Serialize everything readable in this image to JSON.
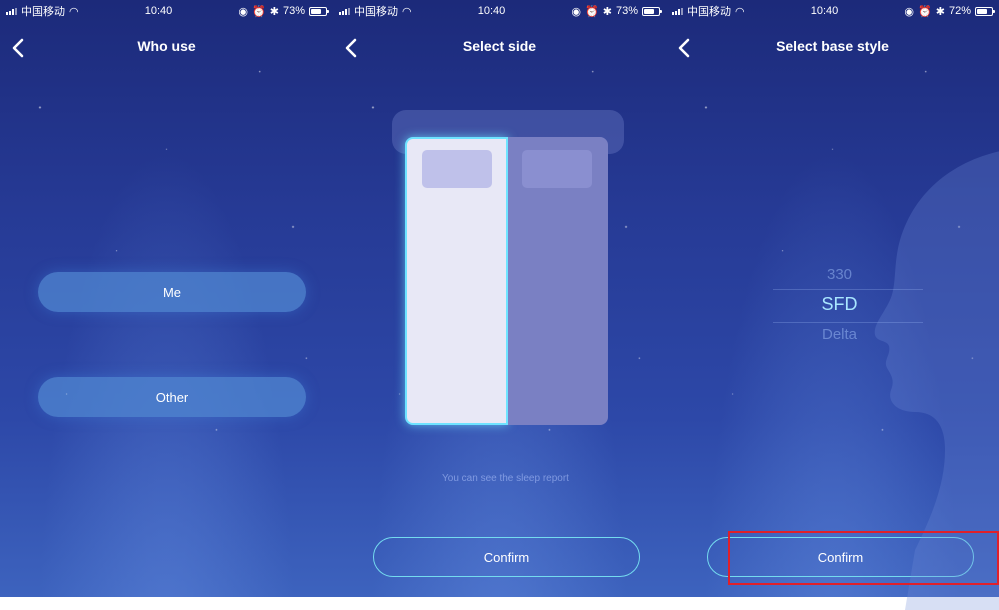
{
  "status": [
    {
      "carrier": "中国移动",
      "time": "10:40",
      "battery": "73%",
      "battery_level": 0.73
    },
    {
      "carrier": "中国移动",
      "time": "10:40",
      "battery": "73%",
      "battery_level": 0.73
    },
    {
      "carrier": "中国移动",
      "time": "10:40",
      "battery": "72%",
      "battery_level": 0.72
    }
  ],
  "screens": {
    "who_use": {
      "title": "Who use",
      "options": [
        "Me",
        "Other"
      ]
    },
    "select_side": {
      "title": "Select side",
      "selected_side": "left",
      "hint": "You can see the sleep report",
      "confirm_label": "Confirm"
    },
    "select_base_style": {
      "title": "Select base style",
      "picker_items": [
        "330",
        "SFD",
        "Delta"
      ],
      "selected_item": "SFD",
      "confirm_label": "Confirm"
    }
  },
  "colors": {
    "background_top": "#1c2a7a",
    "background_bottom": "#3d63be",
    "button_fill": "#5087d2",
    "outline_accent": "#74dbef",
    "selected_side": "#6ee3ff",
    "annotation_red": "#e0202a"
  },
  "icons": {
    "back": "chevron-left-icon",
    "wifi": "wifi-icon",
    "signal": "signal-icon",
    "battery": "battery-icon"
  }
}
